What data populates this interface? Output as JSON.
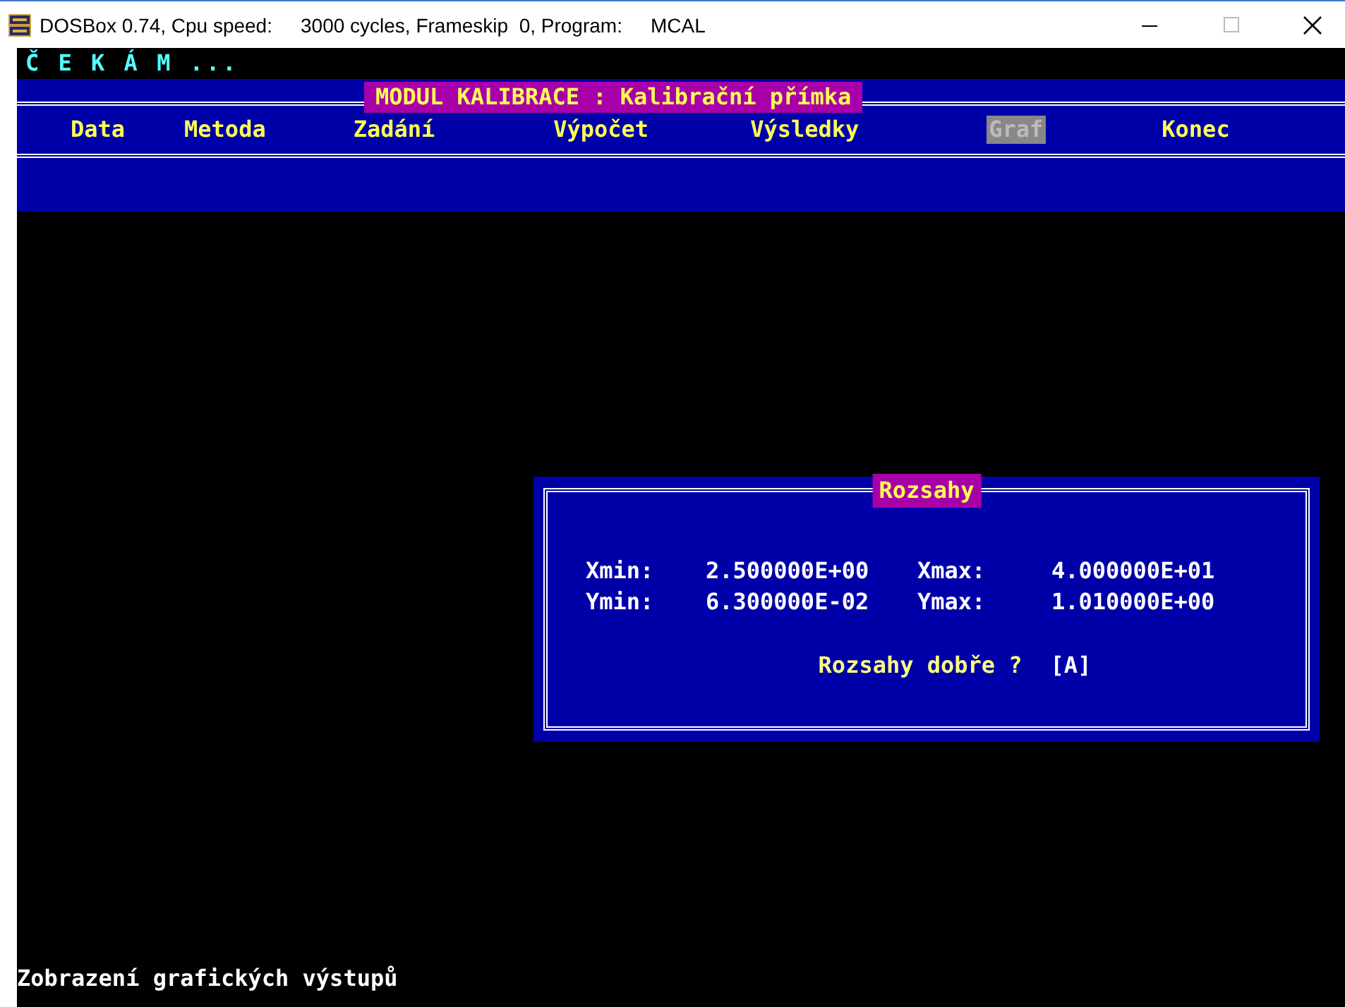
{
  "window": {
    "title_parts": [
      "DOSBox 0.74, Cpu speed:",
      "3000 cycles, Frameskip  0, Program:",
      "MCAL"
    ]
  },
  "status_top": "Č E K Á M ...",
  "menu": {
    "title": "MODUL KALIBRACE : Kalibrační přímka",
    "items": [
      {
        "label": "Data",
        "selected": false
      },
      {
        "label": "Metoda",
        "selected": false
      },
      {
        "label": "Zadání",
        "selected": false
      },
      {
        "label": "Výpočet",
        "selected": false
      },
      {
        "label": "Výsledky",
        "selected": false
      },
      {
        "label": "Graf",
        "selected": true
      },
      {
        "label": "Konec",
        "selected": false
      }
    ]
  },
  "dialog": {
    "title": "Rozsahy",
    "rows": [
      {
        "label": "Xmin:",
        "value": "2.500000E+00",
        "label2": "Xmax:",
        "value2": "4.000000E+01"
      },
      {
        "label": "Ymin:",
        "value": "6.300000E-02",
        "label2": "Ymax:",
        "value2": "1.010000E+00"
      }
    ],
    "question": "Rozsahy dobře ?",
    "answer": "[A]"
  },
  "status_bottom": "Zobrazení grafických výstupů"
}
